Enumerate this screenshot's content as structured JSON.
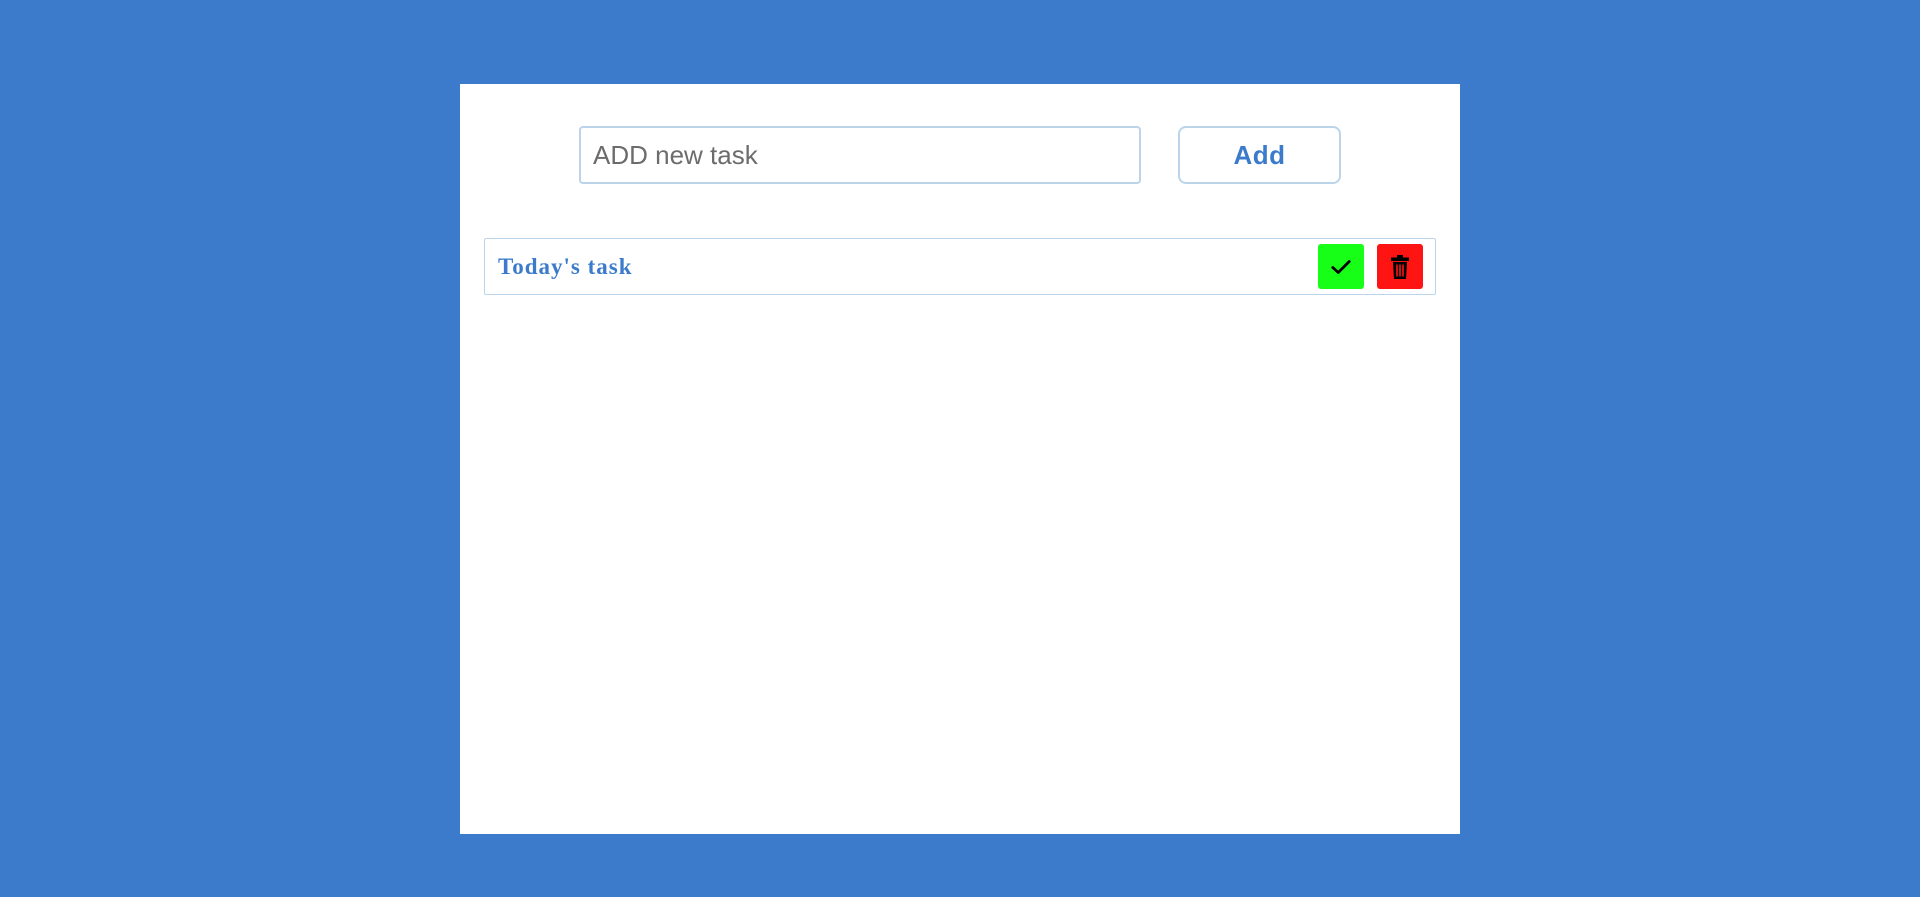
{
  "colors": {
    "background": "#3c7bcb",
    "panel": "#ffffff",
    "accent": "#3c7bcb",
    "border": "#bcd4ea",
    "complete": "#17ff17",
    "delete": "#ff1414"
  },
  "new_task": {
    "placeholder": "ADD new task",
    "value": ""
  },
  "add_button": {
    "label": "Add"
  },
  "tasks": [
    {
      "label": "Today's task",
      "complete_icon": "check-icon",
      "delete_icon": "trash-icon"
    }
  ]
}
